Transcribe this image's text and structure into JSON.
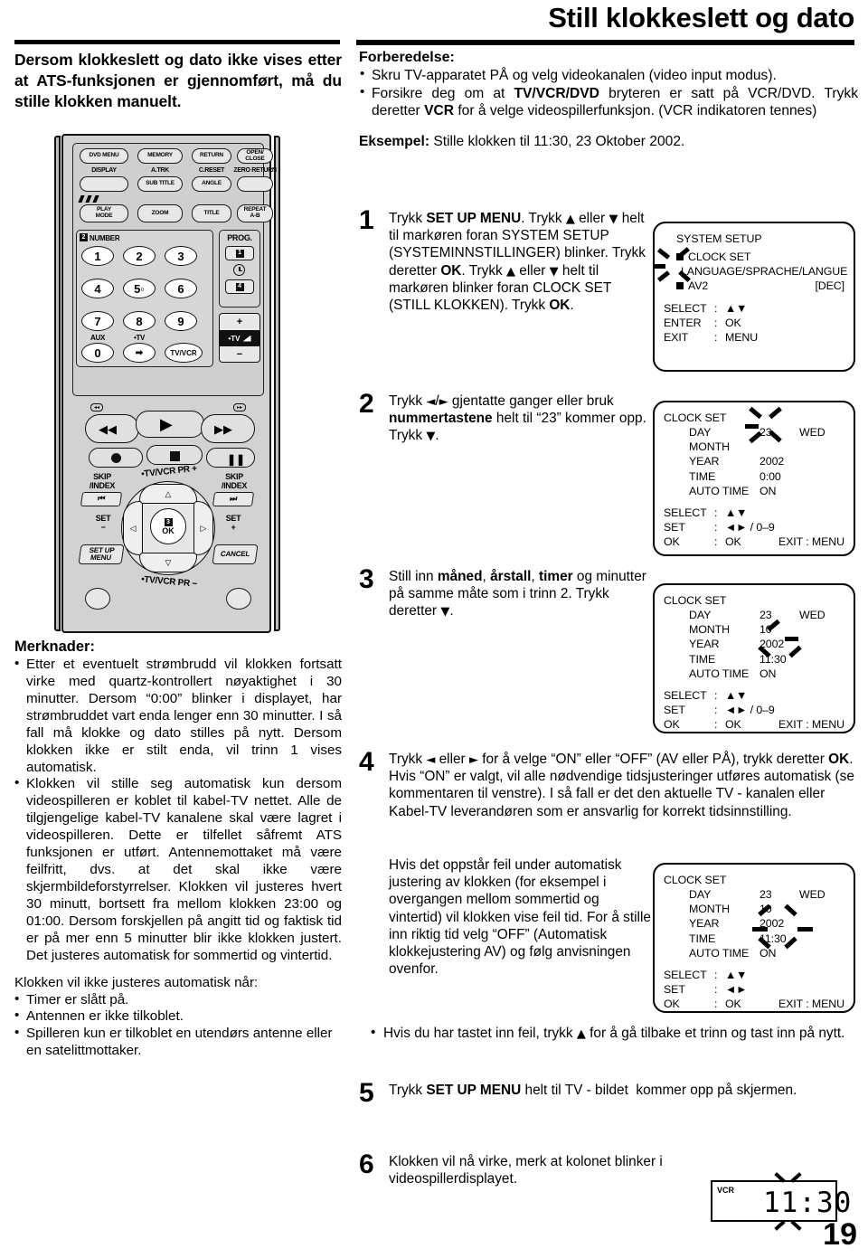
{
  "header": {
    "title": "Still klokkeslett og dato"
  },
  "left": {
    "lead": "Dersom klokkeslett og dato ikke vises etter at ATS-funksjonen er gjennomført, må du stille klokken manuelt.",
    "notes_title": "Merknader:",
    "notes": [
      "Etter et eventuelt strømbrudd vil klokken fortsatt virke med quartz-kontrollert nøyaktighet i 30 minutter. Dersom “0:00” blinker i displayet, har strømbruddet vart enda lenger enn 30 minutter. I så fall må klokke og dato stilles på nytt. Dersom klokken ikke er stilt enda, vil trinn 1 vises automatisk.",
      "Klokken vil stille seg automatisk kun dersom videospilleren er koblet til kabel-TV nettet. Alle de tilgjengelige kabel-TV kanalene skal være lagret i videospilleren. Dette er tilfellet såfremt ATS funksjonen er utført. Antennemottaket må være feilfritt, dvs. at det skal ikke være skjermbildeforstyrrelser. Klokken vil justeres hvert 30 minutt, bortsett fra mellom klokken 23:00 og 01:00. Dersom forskjellen på angitt tid og faktisk tid er på mer enn 5 minutter blir ikke klokken justert. Det justeres automatisk for sommertid og vintertid."
    ],
    "notes_intro2": "Klokken vil ikke justeres automatisk når:",
    "notes_sub": [
      "Timer er slått på.",
      "Antennen er ikke tilkoblet.",
      "Spilleren kun er tilkoblet en utendørs antenne eller en satelittmottaker."
    ]
  },
  "remote": {
    "top_row": [
      "DVD MENU",
      "MEMORY",
      "RETURN",
      "OPEN/\nCLOSE"
    ],
    "labels_row2": [
      "DISPLAY",
      "A.TRK",
      "C.RESET",
      "ZERO RETURN"
    ],
    "row2_buttons": [
      "",
      "SUB TITLE",
      "ANGLE",
      ""
    ],
    "row3_buttons": [
      "PLAY\nMODE",
      "ZOOM",
      "TITLE",
      "REPEAT\nA-B"
    ],
    "number_section_label": "NUMBER",
    "number_marker": "2",
    "numbers": [
      "1",
      "2",
      "3",
      "4",
      "5◦",
      "6",
      "7",
      "8",
      "9",
      "0"
    ],
    "aux_label": "AUX",
    "tv_label": "•TV",
    "tvvcr_label": "TV/VCR",
    "prog_label": "PROG.",
    "prog_marker1": "1",
    "prog_marker2": "4",
    "tv_vol_label": "•TV",
    "vol_plus": "+",
    "vol_minus": "−",
    "skip_left": "SKIP\n/INDEX",
    "skip_right": "SKIP\n/INDEX",
    "pr_up": "•TV/VCR PR +",
    "pr_down": "•TV/VCR PR −",
    "ok_label": "OK",
    "ok_marker": "3",
    "set_minus": "SET\n−",
    "set_plus": "SET\n+",
    "setup_menu": "SET UP\nMENU",
    "cancel": "CANCEL"
  },
  "right": {
    "prep_title": "Forberedelse:",
    "prep_bullets": [
      "Skru TV-apparatet PÅ og velg videokanalen (video input modus).",
      "Forsikre deg om at TV/VCR/DVD bryteren er satt på VCR/DVD. Trykk deretter VCR for å velge videospillerfunksjon. (VCR indikatoren tennes)"
    ],
    "example_label": "Eksempel:",
    "example_text": "Stille klokken til 11:30, 23 Oktober 2002.",
    "steps": [
      {
        "num": "1",
        "text": "Trykk SET UP MENU. Trykk ▲ eller ▼ helt til markøren foran SYSTEM SETUP (SYSTEMINNSTILLINGER) blinker. Trykk deretter OK. Trykk ▲ eller ▼ helt til markøren blinker foran CLOCK SET (STILL KLOKKEN). Trykk OK."
      },
      {
        "num": "2",
        "text": "Trykk ◄/► gjentatte ganger eller bruk nummertastene helt til “23” kommer opp. Trykk ▼."
      },
      {
        "num": "3",
        "text": "Still inn måned, årstall, timer og minutter på samme måte som i trinn 2. Trykk deretter ▼."
      },
      {
        "num": "4",
        "text": "Trykk ◄ eller ► for å velge “ON” eller “OFF” (AV eller PÅ), trykk deretter OK. Hvis “ON” er valgt, vil alle nødvendige tidsjusteringer utføres automatisk (se kommentaren til venstre). I så fall er det den aktuelle TV - kanalen eller Kabel-TV leverandøren som er ansvarlig for korrekt tidsinnstilling."
      },
      {
        "num": "5",
        "text": "Trykk SET UP MENU helt til TV - bildet  kommer opp på skjermen."
      },
      {
        "num": "6",
        "text": "Klokken vil nå virke, merk at kolonet blinker i videospillerdisplayet."
      }
    ],
    "step4_extra": "Hvis det oppstår feil under automatisk justering av klokken (for eksempel i overgangen mellom sommertid og vintertid) vil klokken vise feil tid. For å stille inn riktig tid velg “OFF” (Automatisk klokkejustering AV) og følg anvisningen ovenfor.",
    "step4_note": "Hvis du har tastet inn feil, trykk ▲ for å gå tilbake et trinn og tast inn på nytt."
  },
  "osd1": {
    "title": "SYSTEM SETUP",
    "items": [
      {
        "label": "CLOCK SET",
        "value": ""
      },
      {
        "label": "LANGUAGE/SPRACHE/LANGUE",
        "value": ""
      },
      {
        "label": "AV2",
        "value": "[DEC]"
      }
    ],
    "footer": [
      {
        "k": "SELECT",
        "sep": ":",
        "v": "▲▼"
      },
      {
        "k": "ENTER",
        "sep": ":",
        "v": "OK"
      },
      {
        "k": "EXIT",
        "sep": ":",
        "v": "MENU"
      }
    ]
  },
  "osd2": {
    "title": "CLOCK SET",
    "rows": [
      {
        "label": "DAY",
        "value": "23",
        "extra": "WED"
      },
      {
        "label": "MONTH",
        "value": "",
        "extra": ""
      },
      {
        "label": "YEAR",
        "value": "2002",
        "extra": ""
      },
      {
        "label": "TIME",
        "value": "0:00",
        "extra": ""
      },
      {
        "label": "AUTO TIME",
        "value": "ON",
        "extra": ""
      }
    ],
    "footer": [
      {
        "k": "SELECT",
        "sep": ":",
        "v": "▲▼"
      },
      {
        "k": "SET",
        "sep": ":",
        "v": "◄► / 0–9"
      },
      {
        "k": "OK",
        "sep": ":",
        "v": "OK"
      }
    ],
    "exit": "EXIT : MENU"
  },
  "osd3": {
    "title": "CLOCK SET",
    "rows": [
      {
        "label": "DAY",
        "value": "23",
        "extra": "WED"
      },
      {
        "label": "MONTH",
        "value": "10",
        "extra": ""
      },
      {
        "label": "YEAR",
        "value": "2002",
        "extra": ""
      },
      {
        "label": "TIME",
        "value": "11:30",
        "extra": ""
      },
      {
        "label": "AUTO TIME",
        "value": "ON",
        "extra": ""
      }
    ],
    "footer": [
      {
        "k": "SELECT",
        "sep": ":",
        "v": "▲▼"
      },
      {
        "k": "SET",
        "sep": ":",
        "v": "◄► / 0–9"
      },
      {
        "k": "OK",
        "sep": ":",
        "v": "OK"
      }
    ],
    "exit": "EXIT : MENU"
  },
  "osd4": {
    "title": "CLOCK SET",
    "rows": [
      {
        "label": "DAY",
        "value": "23",
        "extra": "WED"
      },
      {
        "label": "MONTH",
        "value": "10",
        "extra": ""
      },
      {
        "label": "YEAR",
        "value": "2002",
        "extra": ""
      },
      {
        "label": "TIME",
        "value": "11:30",
        "extra": ""
      },
      {
        "label": "AUTO TIME",
        "value": "ON",
        "extra": ""
      }
    ],
    "footer": [
      {
        "k": "SELECT",
        "sep": ":",
        "v": "▲▼"
      },
      {
        "k": "SET",
        "sep": ":",
        "v": "◄►"
      },
      {
        "k": "OK",
        "sep": ":",
        "v": "OK"
      }
    ],
    "exit": "EXIT : MENU"
  },
  "vcr_display": {
    "label": "VCR",
    "time": "11:30"
  },
  "page_number": "19",
  "colors": {
    "ink": "#000000",
    "remote_body": "#d2d2d2",
    "button_face": "#e8e8e8"
  }
}
